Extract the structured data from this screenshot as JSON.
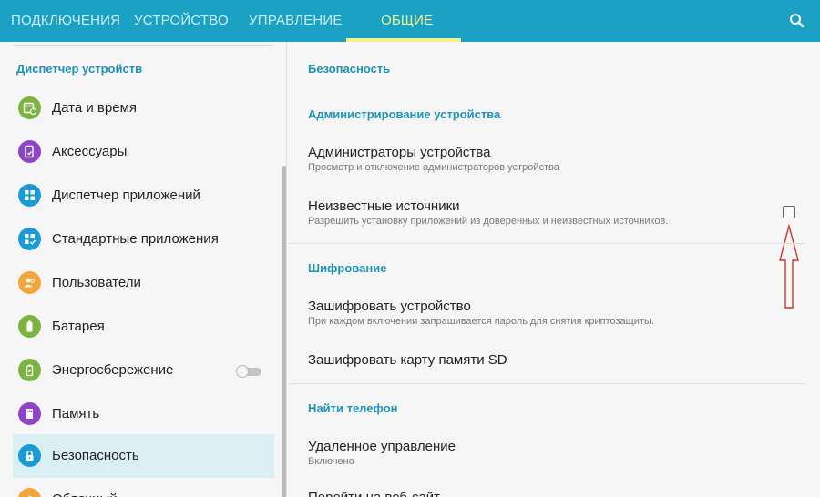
{
  "tabs": [
    {
      "label": "ПОДКЛЮЧЕНИЯ",
      "active": false
    },
    {
      "label": "УСТРОЙСТВО",
      "active": false
    },
    {
      "label": "УПРАВЛЕНИЕ",
      "active": false
    },
    {
      "label": "ОБЩИЕ",
      "active": true
    }
  ],
  "colors": {
    "tab_bar": "#1aa1c3",
    "active_tab": "#f3ef8c",
    "section_header": "#1c93b7",
    "selected_row": "#d9eff4",
    "annotation_arrow": "#d9302a"
  },
  "left_panel": {
    "header": "Диспетчер устройств",
    "items": [
      {
        "label": "Дата и время",
        "icon": "calendar-clock-icon",
        "color": "#7cb342"
      },
      {
        "label": "Аксессуары",
        "icon": "accessory-icon",
        "color": "#8e44c6"
      },
      {
        "label": "Диспетчер приложений",
        "icon": "apps-grid-icon",
        "color": "#1a9ad6"
      },
      {
        "label": "Стандартные приложения",
        "icon": "apps-check-icon",
        "color": "#1a9ad6"
      },
      {
        "label": "Пользователи",
        "icon": "users-icon",
        "color": "#f2a53a"
      },
      {
        "label": "Батарея",
        "icon": "battery-icon",
        "color": "#7cb342"
      },
      {
        "label": "Энергосбережение",
        "icon": "power-saving-icon",
        "color": "#7cb342",
        "toggle": false
      },
      {
        "label": "Память",
        "icon": "memory-icon",
        "color": "#8e44c6"
      },
      {
        "label": "Безопасность",
        "icon": "lock-icon",
        "color": "#1a9ad6",
        "selected": true
      },
      {
        "label": "Облачный",
        "icon": "cloud-icon",
        "color": "#f2a53a"
      }
    ]
  },
  "right_panel": {
    "title": "Безопасность",
    "sections": {
      "admin": {
        "header": "Администрирование устройства",
        "device_admins": {
          "title": "Администраторы устройства",
          "subtitle": "Просмотр и отключение администраторов устройства"
        },
        "unknown_sources": {
          "title": "Неизвестные источники",
          "subtitle": "Разрешить установку приложений из доверенных и неизвестных источников.",
          "checked": false
        }
      },
      "encryption": {
        "header": "Шифрование",
        "encrypt_device": {
          "title": "Зашифровать устройство",
          "subtitle": "При каждом включении запрашивается пароль для снятия криптозащиты."
        },
        "encrypt_sd": {
          "title": "Зашифровать карту памяти SD"
        }
      },
      "find_phone": {
        "header": "Найти телефон",
        "remote_control": {
          "title": "Удаленное управление",
          "subtitle": "Включено"
        },
        "next_item": {
          "title": "Перейти на веб-сайт"
        }
      }
    }
  }
}
